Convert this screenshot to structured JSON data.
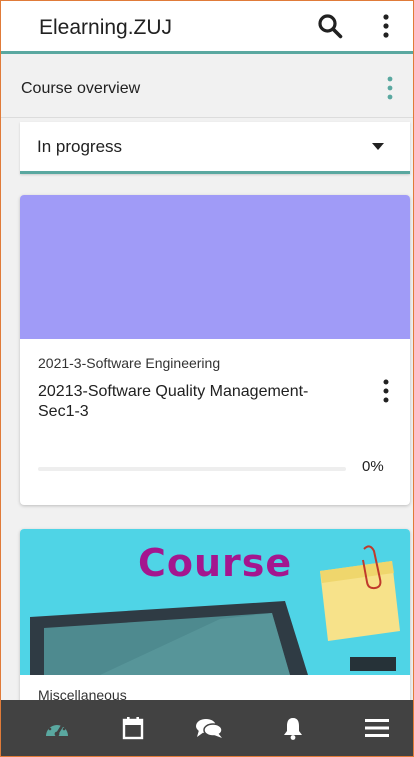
{
  "app": {
    "title": "Elearning.ZUJ"
  },
  "overview": {
    "title": "Course overview"
  },
  "filter": {
    "selected": "In progress"
  },
  "courses": [
    {
      "category": "2021-3-Software Engineering",
      "name": "20213-Software Quality Management-Sec1-3",
      "progress_percent": 0,
      "progress_text": "0%",
      "banner_color": "#a09bf7"
    },
    {
      "category": "Miscellaneous",
      "banner_text": "Course",
      "banner_color": "#4fd4e6"
    }
  ],
  "bottom_nav": [
    {
      "icon": "dashboard-icon",
      "active": true
    },
    {
      "icon": "calendar-icon",
      "active": false
    },
    {
      "icon": "messages-icon",
      "active": false
    },
    {
      "icon": "bell-icon",
      "active": false
    },
    {
      "icon": "menu-icon",
      "active": false
    }
  ],
  "colors": {
    "accent": "#5aa8a0",
    "nav_bg": "#424242",
    "border": "#e07b39"
  }
}
